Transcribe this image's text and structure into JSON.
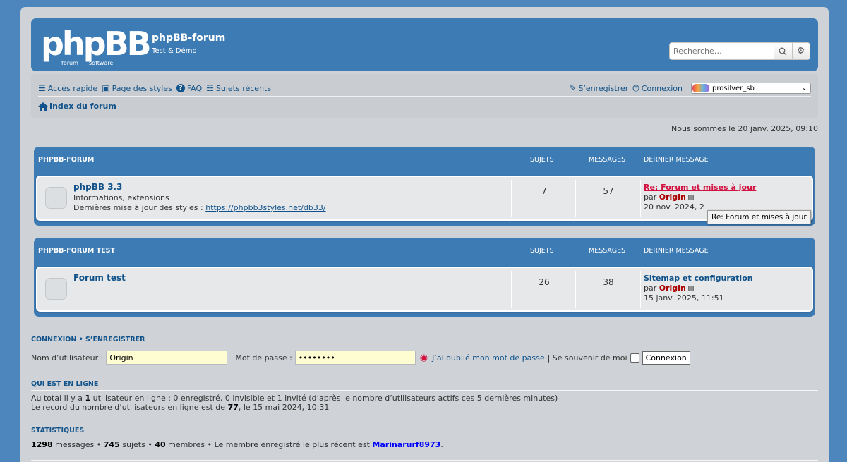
{
  "header": {
    "logo_text": "phpBB",
    "logo_sub1": "forum",
    "logo_sub2": "software",
    "site_title": "phpBB-forum",
    "site_desc": "Test & Démo",
    "search_placeholder": "Recherche…"
  },
  "nav": {
    "quick_access": "Accès rapide",
    "styles_page": "Page des styles",
    "faq": "FAQ",
    "recent_topics": "Sujets récents",
    "register": "S’enregistrer",
    "login": "Connexion",
    "style_selected": "prosilver_sb",
    "breadcrumb": "Index du forum"
  },
  "current_date": "Nous sommes le 20 janv. 2025, 09:10",
  "categories": [
    {
      "name": "PHPBB-FORUM",
      "col_topics": "SUJETS",
      "col_posts": "MESSAGES",
      "col_last": "DERNIER MESSAGE",
      "forum": {
        "title": "phpBB 3.3",
        "desc_line1": "Informations, extensions",
        "desc_line2": "Dernières mise à jour des styles : ",
        "desc_link": "https://phpbb3styles.net/db33/",
        "topics": "7",
        "posts": "57",
        "last_title": "Re: Forum et mises à jour",
        "last_by_prefix": "par",
        "last_by": "Origin",
        "last_date": "20 nov. 2024, 2"
      }
    },
    {
      "name": "PHPBB-FORUM TEST",
      "col_topics": "SUJETS",
      "col_posts": "MESSAGES",
      "col_last": "DERNIER MESSAGE",
      "forum": {
        "title": "Forum test",
        "topics": "26",
        "posts": "38",
        "last_title": "Sitemap et configuration",
        "last_by_prefix": "par",
        "last_by": "Origin",
        "last_date": "15 janv. 2025, 11:51"
      }
    }
  ],
  "tooltip": "Re: Forum et mises à jour",
  "login": {
    "heading": "CONNEXION • S’ENREGISTRER",
    "username_label": "Nom d’utilisateur :",
    "username_value": "Origin",
    "password_label": "Mot de passe :",
    "password_value": "••••••••",
    "forgot": "J’ai oublié mon mot de passe",
    "remember": "| Se souvenir de moi",
    "submit": "Connexion"
  },
  "online": {
    "heading": "QUI EST EN LIGNE",
    "line1_a": "Au total il y a ",
    "line1_n": "1",
    "line1_b": " utilisateur en ligne : 0 enregistré, 0 invisible et 1 invité (d’après le nombre d’utilisateurs actifs ces 5 dernières minutes)",
    "line2_a": "Le record du nombre d’utilisateurs en ligne est de ",
    "line2_n": "77",
    "line2_b": ", le 15 mai 2024, 10:31"
  },
  "stats": {
    "heading": "STATISTIQUES",
    "messages_n": "1298",
    "messages_t": " messages • ",
    "topics_n": "745",
    "topics_t": " sujets • ",
    "members_n": "40",
    "members_t": " membres • Le membre enregistré le plus récent est ",
    "newest": "Marinarurf8973",
    "end": "."
  },
  "colors": {
    "accent": "#3d7bb5",
    "link": "#105289",
    "hot": "#d31141"
  }
}
